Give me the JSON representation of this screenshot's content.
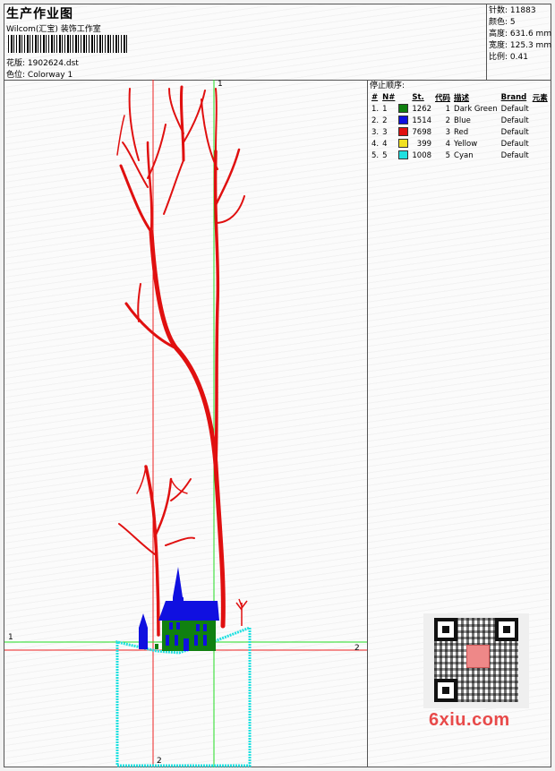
{
  "header": {
    "title": "生产作业图",
    "company": "Wilcom(汇宝) 装饰工作室",
    "design_label": "花版:",
    "design_file": "1902624.dst",
    "colorway_label": "色位:",
    "colorway": "Colorway 1"
  },
  "stats": {
    "stitches_label": "针数:",
    "stitches": "11883",
    "colors_label": "颜色:",
    "colors": "5",
    "height_label": "高度:",
    "height": "631.6 mm",
    "width_label": "宽度:",
    "width": "125.3 mm",
    "scale_label": "比例:",
    "scale": "0.41"
  },
  "legend": {
    "title": "停止顺序:",
    "headers": [
      "#",
      "N#",
      "St.",
      "代码",
      "描述",
      "Brand",
      "元素"
    ],
    "rows": [
      {
        "idx": "1.",
        "n": "1",
        "color": "#108010",
        "st": "1262",
        "code": "1",
        "desc": "Dark Green",
        "brand": "Default"
      },
      {
        "idx": "2.",
        "n": "2",
        "color": "#1010e0",
        "st": "1514",
        "code": "2",
        "desc": "Blue",
        "brand": "Default"
      },
      {
        "idx": "3.",
        "n": "3",
        "color": "#e01010",
        "st": "7698",
        "code": "3",
        "desc": "Red",
        "brand": "Default"
      },
      {
        "idx": "4.",
        "n": "4",
        "color": "#f0e020",
        "st": "399",
        "code": "4",
        "desc": "Yellow",
        "brand": "Default"
      },
      {
        "idx": "5.",
        "n": "5",
        "color": "#20e0e0",
        "st": "1008",
        "code": "5",
        "desc": "Cyan",
        "brand": "Default"
      }
    ]
  },
  "guides": {
    "v_green": "1",
    "h_green": "1",
    "h_red": "2",
    "v_red": "2"
  },
  "watermark": "6xiu.com",
  "colors": {
    "red": "#e01010",
    "green": "#108010",
    "blue": "#1010e0",
    "cyan": "#20e0e0",
    "guide_green": "#22dd22",
    "guide_red": "#ee2222"
  }
}
